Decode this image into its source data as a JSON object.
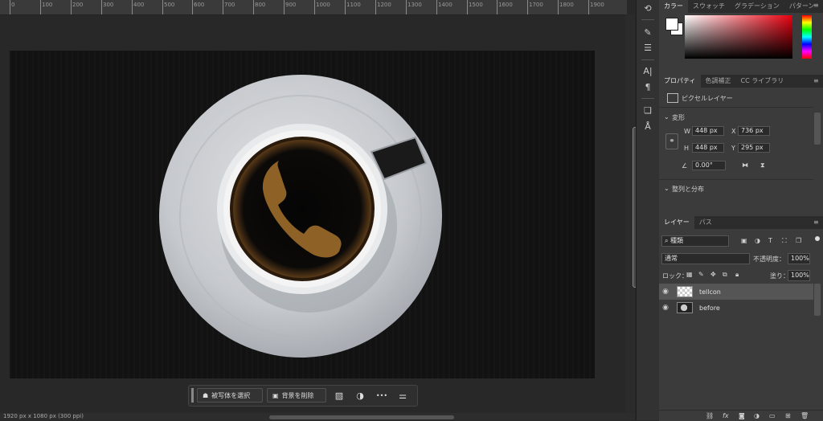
{
  "ruler": {
    "labels": [
      "0",
      "100",
      "200",
      "300",
      "400",
      "500",
      "600",
      "700",
      "800",
      "900",
      "1000",
      "1100",
      "1200",
      "1300",
      "1400",
      "1500",
      "1600",
      "1700",
      "1800",
      "1900"
    ]
  },
  "status": {
    "doc_info": "1920 px x 1080 px (300 ppi)"
  },
  "taskbar": {
    "select_subject": "被写体を選択",
    "remove_background": "背景を削除",
    "more": "•••"
  },
  "color_panel": {
    "tabs": [
      "カラー",
      "スウォッチ",
      "グラデーション",
      "パターン"
    ],
    "active_tab": "カラー",
    "foreground": "#ffffff",
    "background": "#ffffff"
  },
  "properties_panel": {
    "tabs": [
      "プロパティ",
      "色調補正",
      "CC ライブラリ"
    ],
    "active_tab": "プロパティ",
    "layer_type": "ピクセルレイヤー",
    "transform_header": "変形",
    "w_label": "W",
    "w_value": "448 px",
    "x_label": "X",
    "x_value": "736 px",
    "h_label": "H",
    "h_value": "448 px",
    "y_label": "Y",
    "y_value": "295 px",
    "angle_value": "0.00°",
    "align_header": "整列と分布"
  },
  "layers_panel": {
    "tabs": [
      "レイヤー",
      "パス"
    ],
    "active_tab": "レイヤー",
    "filter_kind": "種類",
    "blend_mode": "通常",
    "opacity_label": "不透明度：",
    "opacity_value": "100%",
    "lock_label": "ロック：",
    "fill_label": "塗り：",
    "fill_value": "100%",
    "layers": [
      {
        "name": "tellcon",
        "selected": true
      },
      {
        "name": "before",
        "selected": false
      }
    ],
    "footer_icons": [
      "link-icon",
      "fx-icon",
      "mask-icon",
      "adjustment-icon",
      "folder-icon",
      "new-layer-icon",
      "trash-icon"
    ]
  }
}
